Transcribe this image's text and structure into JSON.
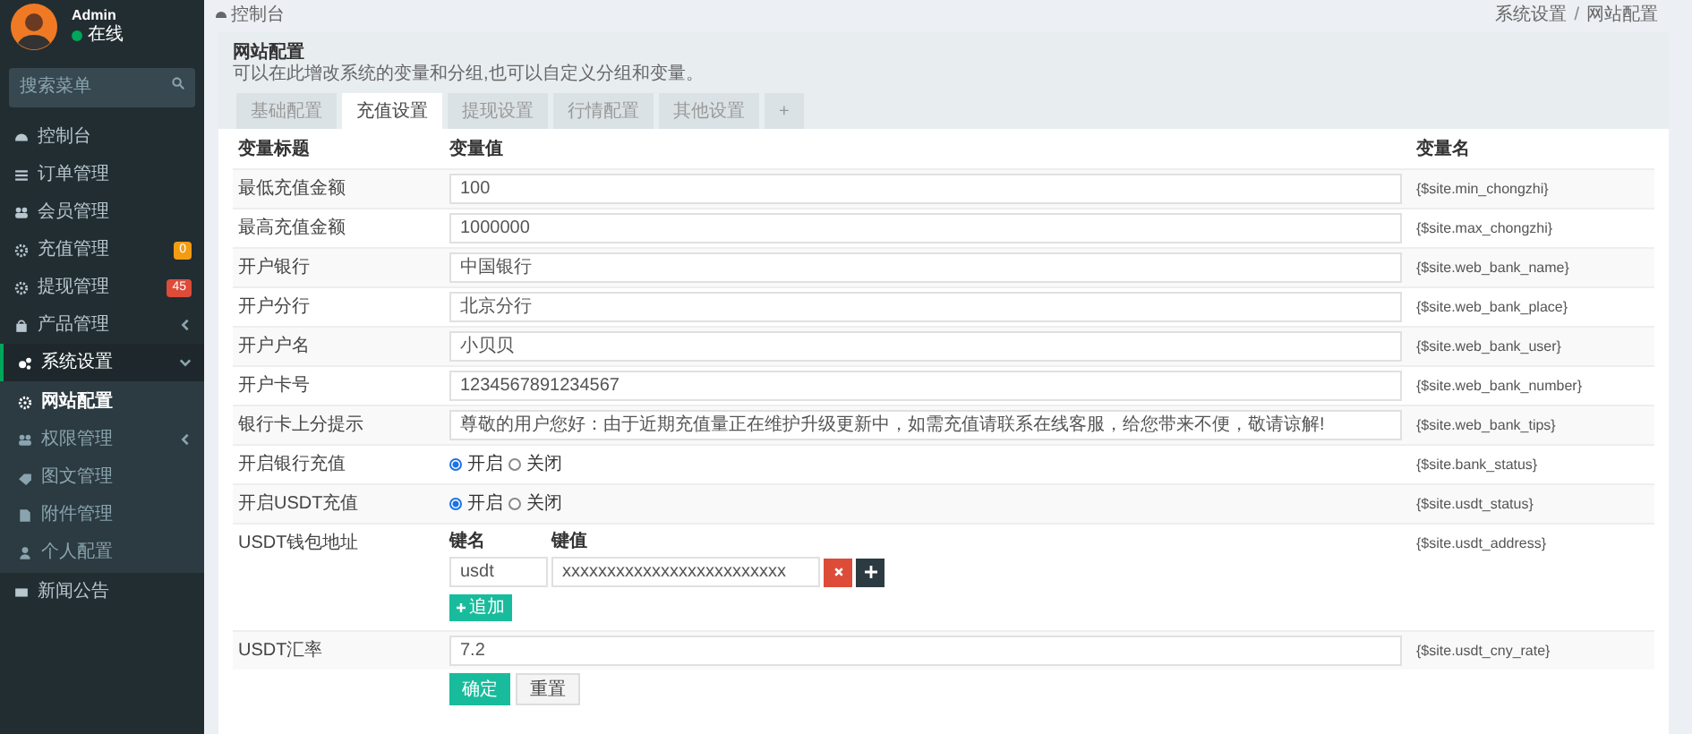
{
  "user": {
    "name": "Admin",
    "status": "在线"
  },
  "sidebar": {
    "search": {
      "placeholder": "搜索菜单"
    },
    "items": [
      {
        "label": "控制台",
        "selected": false
      },
      {
        "label": "订单管理",
        "selected": false
      },
      {
        "label": "会员管理",
        "selected": false
      },
      {
        "label": "充值管理",
        "selected": false,
        "badge": {
          "text": "0",
          "color": "#f39c12"
        }
      },
      {
        "label": "提现管理",
        "selected": false,
        "badge": {
          "text": "45",
          "color": "#dd4b39"
        }
      },
      {
        "label": "产品管理",
        "selected": false,
        "expanded": false
      },
      {
        "label": "系统设置",
        "selected": true,
        "expanded": true,
        "children": [
          {
            "label": "网站配置",
            "selected": true
          },
          {
            "label": "权限管理",
            "selected": false,
            "expanded": false
          },
          {
            "label": "图文管理",
            "selected": false
          },
          {
            "label": "附件管理",
            "selected": false
          },
          {
            "label": "个人配置",
            "selected": false
          }
        ]
      },
      {
        "label": "新闻公告",
        "selected": false
      }
    ]
  },
  "breadcrumb": {
    "home": "控制台",
    "trail": [
      "系统设置",
      "网站配置"
    ],
    "separator": "/"
  },
  "panel": {
    "title": "网站配置",
    "description": "可以在此增改系统的变量和分组,也可以自定义分组和变量。",
    "tabs": [
      {
        "label": "基础配置",
        "selected": false
      },
      {
        "label": "充值设置",
        "selected": true
      },
      {
        "label": "提现设置",
        "selected": false
      },
      {
        "label": "行情配置",
        "selected": false
      },
      {
        "label": "其他设置",
        "selected": false
      },
      {
        "label": "+",
        "selected": false
      }
    ]
  },
  "table": {
    "columns": [
      "变量标题",
      "变量值",
      "变量名"
    ],
    "rows": [
      {
        "kind": "input",
        "title": "最低充值金额",
        "value": "100",
        "name": "{$site.min_chongzhi}"
      },
      {
        "kind": "input",
        "title": "最高充值金额",
        "value": "1000000",
        "name": "{$site.max_chongzhi}"
      },
      {
        "kind": "input",
        "title": "开户银行",
        "value": "中国银行",
        "name": "{$site.web_bank_name}"
      },
      {
        "kind": "input",
        "title": "开户分行",
        "value": "北京分行",
        "name": "{$site.web_bank_place}"
      },
      {
        "kind": "input",
        "title": "开户户名",
        "value": "小贝贝",
        "name": "{$site.web_bank_user}"
      },
      {
        "kind": "input",
        "title": "开户卡号",
        "value": "1234567891234567",
        "name": "{$site.web_bank_number}"
      },
      {
        "kind": "input",
        "title": "银行卡上分提示",
        "value": "尊敬的用户您好：由于近期充值量正在维护升级更新中，如需充值请联系在线客服，给您带来不便，敬请谅解!",
        "name": "{$site.web_bank_tips}"
      },
      {
        "kind": "radio",
        "title": "开启银行充值",
        "options": [
          {
            "label": "开启",
            "selected": true
          },
          {
            "label": "关闭",
            "selected": false
          }
        ],
        "name": "{$site.bank_status}"
      },
      {
        "kind": "radio",
        "title": "开启USDT充值",
        "options": [
          {
            "label": "开启",
            "selected": true
          },
          {
            "label": "关闭",
            "selected": false
          }
        ],
        "name": "{$site.usdt_status}"
      },
      {
        "kind": "array",
        "title": "USDT钱包地址",
        "key_label": "键名",
        "value_label": "键值",
        "pairs": [
          {
            "key": "usdt",
            "value": "xxxxxxxxxxxxxxxxxxxxxxxxx"
          }
        ],
        "add_label": "追加",
        "name": "{$site.usdt_address}"
      },
      {
        "kind": "input",
        "title": "USDT汇率",
        "value": "7.2",
        "name": "{$site.usdt_cny_rate}"
      }
    ]
  },
  "buttons": [
    {
      "label": "确定",
      "kind": "primary"
    },
    {
      "label": "重置",
      "kind": "default"
    }
  ]
}
